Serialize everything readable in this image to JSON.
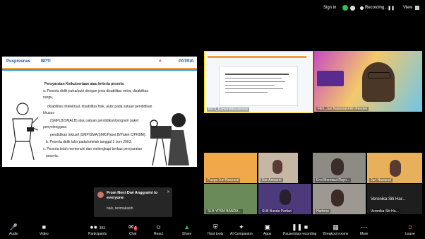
{
  "topbar": {
    "signin": "Sign in",
    "recording": "Recording...",
    "view": "View"
  },
  "slide": {
    "logo_left": "Puspresnas",
    "logo_bpti": "BPTI",
    "logo_r1": "#",
    "logo_r2": "PATRIA",
    "title": "Persyaratan Keikutsertaan atau kriteria peserta",
    "lines": [
      "a. Peserta didik putra/putri dengan jenis disabilitas netra, disabilitas",
      "rungu,",
      "disabilitas intelektual, disabilitas fisik, autis pada satuan pendidikan",
      "khusus",
      "(SMPLB/SMALB) atau satuan pendidikan/program paket",
      "penyelenggara",
      "pendidikan inklusif (SMP/SMA/SMK/Paket B/Paket C/PKBM).",
      "b. Peserta didik lahir pada/setelah tanggal 1 Juni 2003.",
      "c. Peserta telah memenuhi dan melengkapi berkas persyaratan",
      "peserta."
    ]
  },
  "tiles": [
    {
      "name": "BPTI_Kemendikbudristek"
    },
    {
      "name": "Film_Juri Nasional Film Pendek"
    }
  ],
  "small_tiles": [
    {
      "name": "Puspa Juri Nasional"
    },
    {
      "name": "Nur Asmarni"
    },
    {
      "name": "Erni Mermaut Rayn..."
    },
    {
      "name": "Juri Nasional"
    },
    {
      "name": "SLB YPSM BANDA..."
    },
    {
      "name": "SLB Bunda Pertiwi"
    },
    {
      "name": "Hartono"
    },
    {
      "name": "Veronika Siti Har..."
    },
    {
      "name": "Veronika Siti Ha..."
    }
  ],
  "chat": {
    "from": "From Neni Dwi Anggraini to everyone",
    "message": "baik, terimakasih"
  },
  "toolbar": {
    "audio": "Audio",
    "video": "Video",
    "participants": "Participants",
    "participants_count": "393",
    "chat": "Chat",
    "chat_badge": "1",
    "react": "React",
    "share": "Share",
    "host_tools": "Host tools",
    "ai_companion": "AI Companion",
    "apps": "Apps",
    "pause_recording": "Pause/stop recording",
    "breakout": "Breakout rooms",
    "more": "More",
    "leave": "Leave"
  },
  "colors": {
    "accent_green": "#23c552",
    "leave_red": "#e84a4a",
    "active_speaker": "#ffd800"
  }
}
